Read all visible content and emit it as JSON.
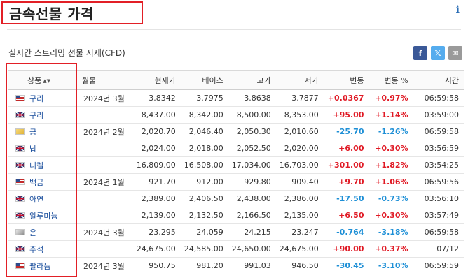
{
  "page": {
    "title": "금속선물 가격",
    "info": "i"
  },
  "subtitle": "실시간 스트리밍 선물 시세(CFD)",
  "share": {
    "facebook": "f",
    "twitter": "𝕏",
    "mail": "✉"
  },
  "table": {
    "headers": [
      "상품",
      "월물",
      "현재가",
      "베이스",
      "고가",
      "저가",
      "변동",
      "변동 %",
      "시간"
    ],
    "sort_indicator": "▲▼",
    "rows": [
      {
        "flag": "us",
        "name": "구리",
        "month": "2024년 3월",
        "last": "3.8342",
        "base": "3.7975",
        "high": "3.8638",
        "low": "3.7877",
        "change": "+0.0367",
        "pct": "+0.97%",
        "time": "06:59:58",
        "dir": "pos"
      },
      {
        "flag": "uk",
        "name": "구리",
        "month": "",
        "last": "8,437.00",
        "base": "8,342.00",
        "high": "8,500.00",
        "low": "8,353.00",
        "change": "+95.00",
        "pct": "+1.14%",
        "time": "03:59:00",
        "dir": "pos"
      },
      {
        "flag": "gold",
        "name": "금",
        "month": "2024년 2월",
        "last": "2,020.70",
        "base": "2,046.40",
        "high": "2,050.30",
        "low": "2,010.60",
        "change": "-25.70",
        "pct": "-1.26%",
        "time": "06:59:58",
        "dir": "neg"
      },
      {
        "flag": "uk",
        "name": "납",
        "month": "",
        "last": "2,024.00",
        "base": "2,018.00",
        "high": "2,052.50",
        "low": "2,020.00",
        "change": "+6.00",
        "pct": "+0.30%",
        "time": "03:56:59",
        "dir": "pos"
      },
      {
        "flag": "uk",
        "name": "니켈",
        "month": "",
        "last": "16,809.00",
        "base": "16,508.00",
        "high": "17,034.00",
        "low": "16,703.00",
        "change": "+301.00",
        "pct": "+1.82%",
        "time": "03:54:25",
        "dir": "pos"
      },
      {
        "flag": "us",
        "name": "백금",
        "month": "2024년 1월",
        "last": "921.70",
        "base": "912.00",
        "high": "929.80",
        "low": "909.40",
        "change": "+9.70",
        "pct": "+1.06%",
        "time": "06:59:56",
        "dir": "pos"
      },
      {
        "flag": "uk",
        "name": "아연",
        "month": "",
        "last": "2,389.00",
        "base": "2,406.50",
        "high": "2,438.00",
        "low": "2,386.00",
        "change": "-17.50",
        "pct": "-0.73%",
        "time": "03:56:10",
        "dir": "neg"
      },
      {
        "flag": "uk",
        "name": "알루미늄",
        "month": "",
        "last": "2,139.00",
        "base": "2,132.50",
        "high": "2,166.50",
        "low": "2,135.00",
        "change": "+6.50",
        "pct": "+0.30%",
        "time": "03:57:49",
        "dir": "pos"
      },
      {
        "flag": "silver",
        "name": "은",
        "month": "2024년 3월",
        "last": "23.295",
        "base": "24.059",
        "high": "24.215",
        "low": "23.247",
        "change": "-0.764",
        "pct": "-3.18%",
        "time": "06:59:58",
        "dir": "neg"
      },
      {
        "flag": "uk",
        "name": "주석",
        "month": "",
        "last": "24,675.00",
        "base": "24,585.00",
        "high": "24,650.00",
        "low": "24,675.00",
        "change": "+90.00",
        "pct": "+0.37%",
        "time": "07/12",
        "dir": "pos"
      },
      {
        "flag": "us",
        "name": "팔라듐",
        "month": "2024년 3월",
        "last": "950.75",
        "base": "981.20",
        "high": "991.03",
        "low": "946.50",
        "change": "-30.45",
        "pct": "-3.10%",
        "time": "06:59:59",
        "dir": "neg"
      }
    ]
  },
  "colors": {
    "up": "#e01a25",
    "down": "#1d8fd6",
    "link": "#1a4e9c",
    "highlight": "#e21f26"
  }
}
